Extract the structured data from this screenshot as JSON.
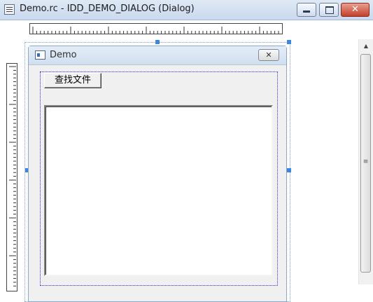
{
  "window": {
    "title": "Demo.rc - IDD_DEMO_DIALOG (Dialog)",
    "close_glyph": "✕",
    "icon": "resource-file-icon"
  },
  "dialog": {
    "title": "Demo",
    "close_glyph": "✕",
    "icon": "dialog-window-icon",
    "find_button_label": "查找文件"
  },
  "scrollbar": {
    "up_glyph": "▲",
    "grip_glyph": "≡"
  },
  "colors": {
    "selection_handle": "#3a86e0",
    "guide_dots": "#2a2ad0",
    "dialog_face": "#f0f0f0"
  }
}
